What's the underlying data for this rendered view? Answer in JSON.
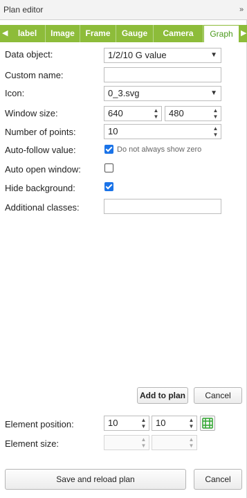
{
  "title": "Plan editor",
  "collapse_label": "»",
  "tabs": [
    {
      "label": "label"
    },
    {
      "label": "Image"
    },
    {
      "label": "Frame"
    },
    {
      "label": "Gauge"
    },
    {
      "label": "Camera"
    },
    {
      "label": "Graph",
      "active": true
    }
  ],
  "form": {
    "data_object": {
      "label": "Data object:",
      "value": "1/2/10 G value"
    },
    "custom_name": {
      "label": "Custom name:",
      "value": ""
    },
    "icon": {
      "label": "Icon:",
      "value": "0_3.svg"
    },
    "window_size": {
      "label": "Window size:",
      "width": "640",
      "height": "480"
    },
    "number_of_points": {
      "label": "Number of points:",
      "value": "10"
    },
    "auto_follow": {
      "label": "Auto-follow value:",
      "checked": true,
      "extra_text": "Do not always show zero"
    },
    "auto_open": {
      "label": "Auto open window:",
      "checked": false
    },
    "hide_background": {
      "label": "Hide background:",
      "checked": true
    },
    "additional_classes": {
      "label": "Additional classes:",
      "value": ""
    }
  },
  "buttons": {
    "add_to_plan": "Add to plan",
    "cancel": "Cancel",
    "save_reload": "Save and reload plan",
    "cancel_bottom": "Cancel"
  },
  "position": {
    "label": "Element position:",
    "x": "10",
    "y": "10"
  },
  "size": {
    "label": "Element size:",
    "w": "",
    "h": ""
  }
}
